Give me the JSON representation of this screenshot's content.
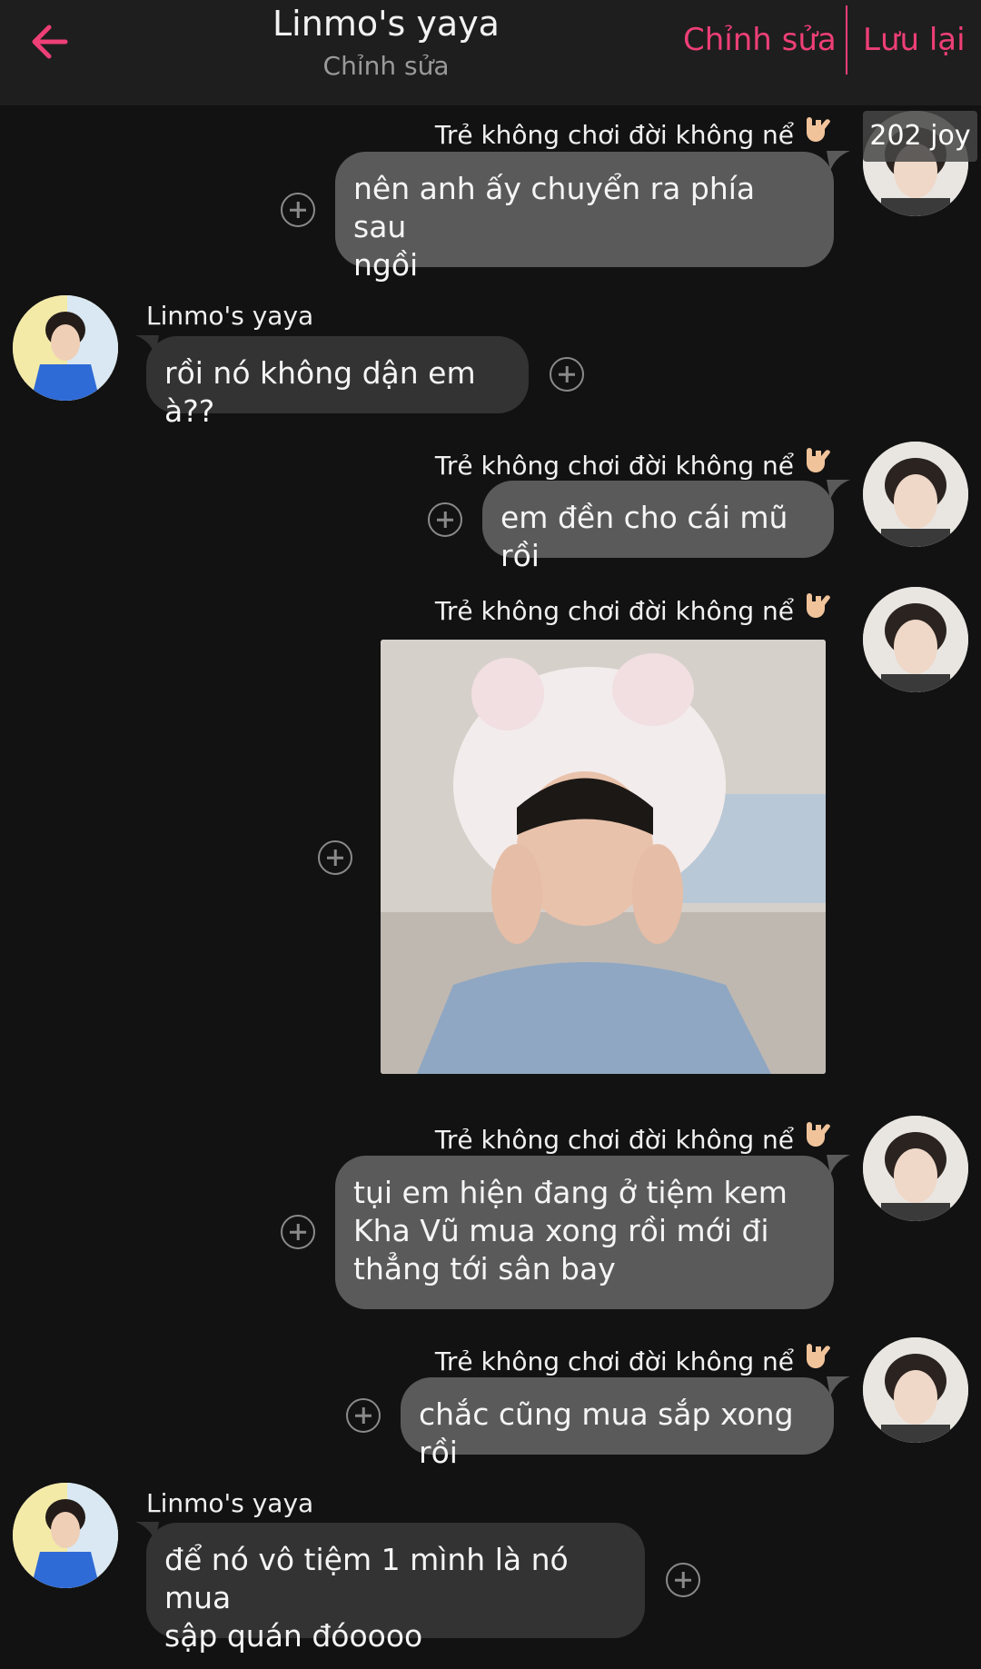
{
  "header": {
    "title": "Linmo's yaya",
    "subtitle": "Chỉnh sửa",
    "edit_label": "Chỉnh sửa",
    "save_label": "Lưu lại"
  },
  "colors": {
    "accent": "#ee3f77",
    "bg": "#121212",
    "bubble_out": "#5a5a5a",
    "bubble_in": "#333333"
  },
  "badge_text": "202 joy",
  "messages": [
    {
      "sender": "Trẻ không chơi đời không nể",
      "side": "right",
      "text_lines": [
        "nên anh ấy chuyển ra phía sau",
        "ngồi"
      ]
    },
    {
      "sender": "Linmo's yaya",
      "side": "left",
      "text_lines": [
        "rồi nó không dận em à??"
      ]
    },
    {
      "sender": "Trẻ không chơi đời không nể",
      "side": "right",
      "text_lines": [
        "em đền cho cái mũ rồi"
      ]
    },
    {
      "sender": "Trẻ không chơi đời không nể",
      "side": "right",
      "image": "photo of person wearing white cat-ear hat in car"
    },
    {
      "sender": "Trẻ không chơi đời không nể",
      "side": "right",
      "text_lines": [
        "tụi em hiện đang ở tiệm kem",
        "Kha Vũ mua xong rồi mới đi",
        "thẳng tới sân bay"
      ]
    },
    {
      "sender": "Trẻ không chơi đời không nể",
      "side": "right",
      "text_lines": [
        "chắc cũng mua sắp xong rồi"
      ]
    },
    {
      "sender": "Linmo's yaya",
      "side": "left",
      "text_lines": [
        "để nó vô tiệm 1 mình là nó mua",
        "sập quán đóoooo"
      ]
    }
  ]
}
